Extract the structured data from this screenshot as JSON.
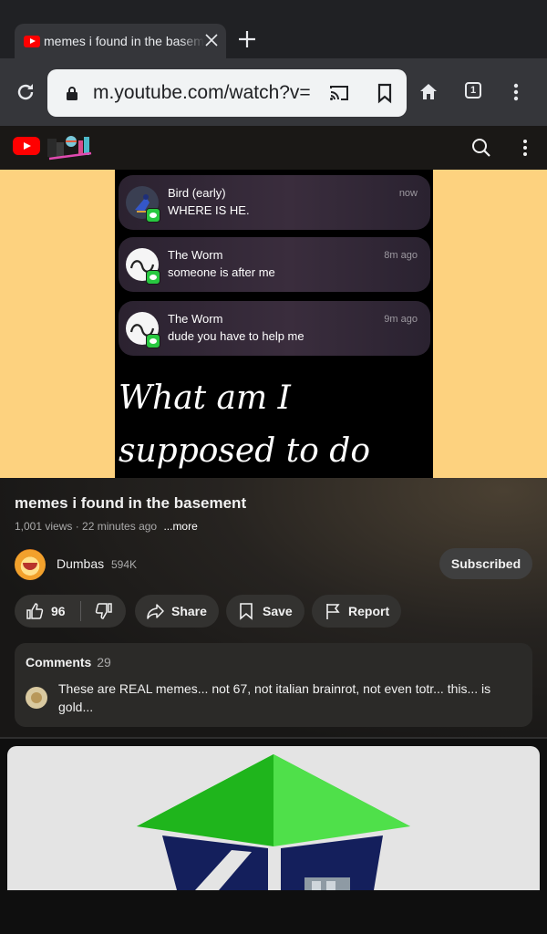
{
  "browser": {
    "tab_title": "memes i found in the basement",
    "url": "m.youtube.com/watch?v=",
    "tab_count": "1"
  },
  "video": {
    "notifications": [
      {
        "name": "Bird (early)",
        "message": "WHERE IS HE.",
        "time": "now"
      },
      {
        "name": "The Worm",
        "message": "someone is after me",
        "time": "8m ago"
      },
      {
        "name": "The Worm",
        "message": "dude you have to help me",
        "time": "9m ago"
      }
    ],
    "caption": "What am I supposed to do here.",
    "title": "memes i found in the basement",
    "meta": "1,001 views · 22 minutes ago",
    "more_label": "...more"
  },
  "channel": {
    "name": "Dumbas",
    "subscribers": "594K",
    "subscribe_label": "Subscribed"
  },
  "actions": {
    "likes": "96",
    "share_label": "Share",
    "save_label": "Save",
    "report_label": "Report"
  },
  "comments": {
    "label": "Comments",
    "count": "29",
    "top_comment": "These are REAL memes... not 67, not italian brainrot, not even totr... this... is gold..."
  },
  "colors": {
    "youtube_red": "#ff0000",
    "player_letterbox": "#fdd27f",
    "message_badge": "#28c840",
    "thumb_roof": "#22c91f"
  }
}
